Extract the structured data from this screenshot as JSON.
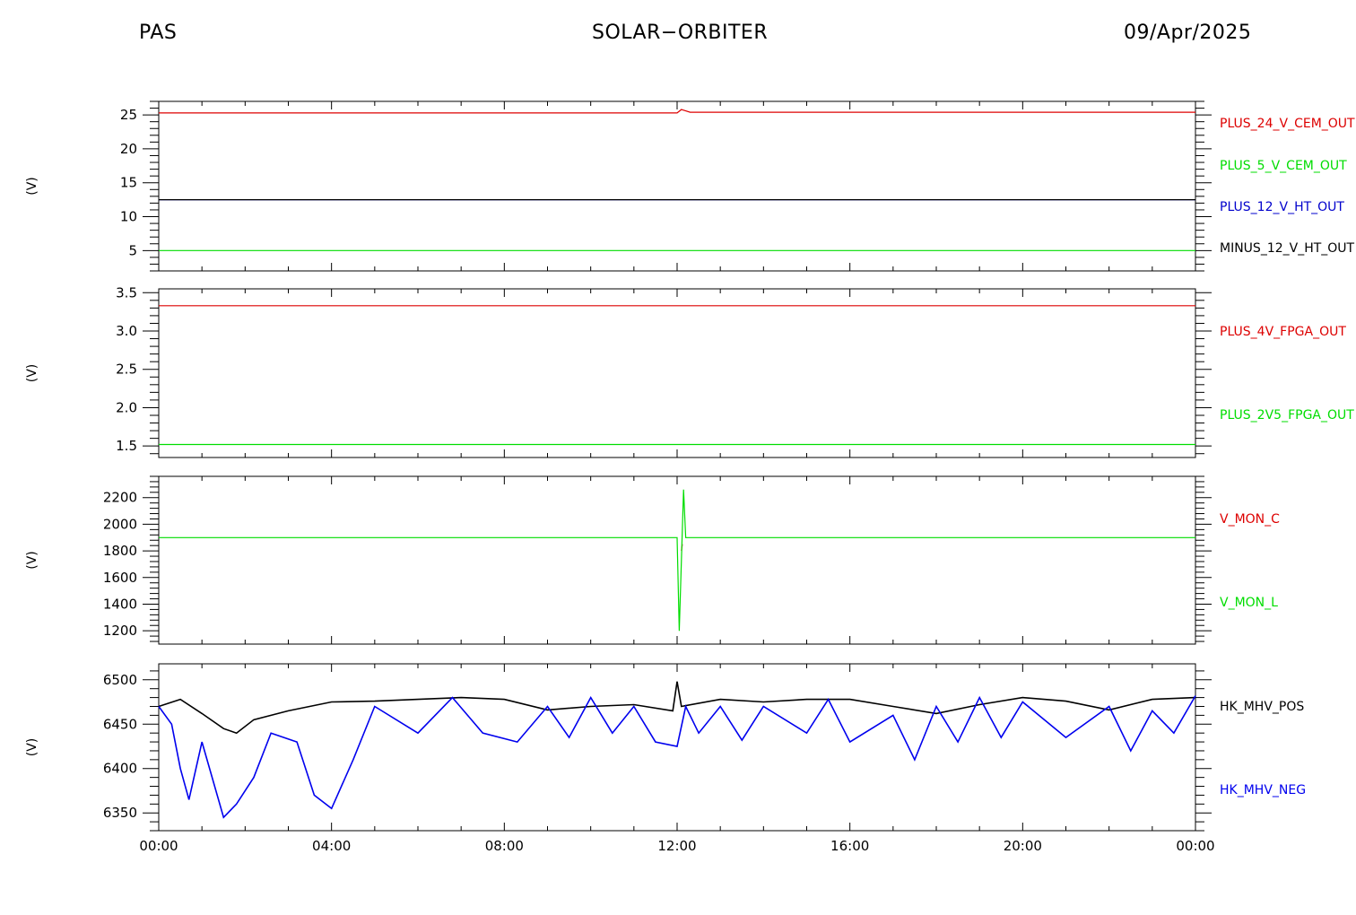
{
  "header": {
    "left": "PAS",
    "center": "SOLAR−ORBITER",
    "right": "09/Apr/2025"
  },
  "chart_data": [
    {
      "type": "line",
      "ylabel": "(V)",
      "ylim": [
        2,
        27
      ],
      "yticks": [
        5,
        10,
        15,
        20,
        25
      ],
      "xlim": [
        "00:00",
        "24:00"
      ],
      "series": [
        {
          "name": "PLUS_24_V_CEM_OUT",
          "color": "#dd0000",
          "x": [
            0,
            12,
            12.1,
            12.3,
            24
          ],
          "y": [
            25.3,
            25.3,
            25.8,
            25.4,
            25.4
          ]
        },
        {
          "name": "PLUS_5_V_CEM_OUT",
          "color": "#00dd00",
          "x": [
            0,
            24
          ],
          "y": [
            5.0,
            5.0
          ]
        },
        {
          "name": "PLUS_12_V_HT_OUT",
          "color": "#0000cc",
          "x": [
            0,
            24
          ],
          "y": [
            12.5,
            12.5
          ]
        },
        {
          "name": "MINUS_12_V_HT_OUT",
          "color": "#000000",
          "x": [
            0,
            24
          ],
          "y": [
            12.5,
            12.5
          ]
        }
      ]
    },
    {
      "type": "line",
      "ylabel": "(V)",
      "ylim": [
        1.35,
        3.55
      ],
      "yticks": [
        1.5,
        2.0,
        2.5,
        3.0,
        3.5
      ],
      "xlim": [
        "00:00",
        "24:00"
      ],
      "series": [
        {
          "name": "PLUS_4V_FPGA_OUT",
          "color": "#dd0000",
          "x": [
            0,
            24
          ],
          "y": [
            3.33,
            3.33
          ]
        },
        {
          "name": "PLUS_2V5_FPGA_OUT",
          "color": "#00dd00",
          "x": [
            0,
            24
          ],
          "y": [
            1.52,
            1.52
          ]
        }
      ]
    },
    {
      "type": "line",
      "ylabel": "(V)",
      "ylim": [
        1100,
        2360
      ],
      "yticks": [
        1200,
        1400,
        1600,
        1800,
        2000,
        2200
      ],
      "xlim": [
        "00:00",
        "24:00"
      ],
      "series": [
        {
          "name": "V_MON_C",
          "color": "#dd0000",
          "x": [
            12.1,
            12.12
          ],
          "y": [
            1800,
            1850
          ]
        },
        {
          "name": "V_MON_L",
          "color": "#00dd00",
          "x": [
            0,
            12.0,
            12.05,
            12.15,
            12.2,
            24
          ],
          "y": [
            1900,
            1900,
            1200,
            2260,
            1900,
            1900
          ]
        }
      ]
    },
    {
      "type": "line",
      "ylabel": "(V)",
      "ylim": [
        6330,
        6518
      ],
      "yticks": [
        6350,
        6400,
        6450,
        6500
      ],
      "xlim": [
        "00:00",
        "24:00"
      ],
      "series": [
        {
          "name": "HK_MHV_POS",
          "color": "#000000",
          "x": [
            0,
            0.5,
            1.0,
            1.5,
            1.8,
            2.2,
            3.0,
            4.0,
            5.0,
            6.0,
            7.0,
            8.0,
            9.0,
            10.0,
            11.0,
            11.9,
            12.0,
            12.1,
            13.0,
            14.0,
            15.0,
            16.0,
            17.0,
            18.0,
            19.0,
            20.0,
            21.0,
            22.0,
            23.0,
            24.0
          ],
          "y": [
            6470,
            6478,
            6462,
            6445,
            6440,
            6455,
            6465,
            6475,
            6476,
            6478,
            6480,
            6478,
            6466,
            6470,
            6472,
            6465,
            6498,
            6470,
            6478,
            6475,
            6478,
            6478,
            6470,
            6462,
            6472,
            6480,
            6476,
            6466,
            6478,
            6480
          ]
        },
        {
          "name": "HK_MHV_NEG",
          "color": "#0000ee",
          "x": [
            0,
            0.3,
            0.5,
            0.7,
            1.0,
            1.5,
            1.8,
            2.2,
            2.6,
            3.2,
            3.6,
            4.0,
            4.5,
            5.0,
            6.0,
            6.8,
            7.5,
            8.3,
            9.0,
            9.5,
            10.0,
            10.5,
            11.0,
            11.5,
            12.0,
            12.2,
            12.5,
            13.0,
            13.5,
            14.0,
            15.0,
            15.5,
            16.0,
            17.0,
            17.5,
            18.0,
            18.5,
            19.0,
            19.5,
            20.0,
            21.0,
            22.0,
            22.5,
            23.0,
            23.5,
            24.0
          ],
          "y": [
            6470,
            6450,
            6400,
            6365,
            6430,
            6345,
            6360,
            6390,
            6440,
            6430,
            6370,
            6355,
            6410,
            6470,
            6440,
            6480,
            6440,
            6430,
            6470,
            6435,
            6480,
            6440,
            6470,
            6430,
            6425,
            6470,
            6440,
            6470,
            6432,
            6470,
            6440,
            6478,
            6430,
            6460,
            6410,
            6470,
            6430,
            6480,
            6435,
            6475,
            6435,
            6470,
            6420,
            6465,
            6440,
            6482
          ]
        }
      ]
    }
  ],
  "xaxis": {
    "ticks": [
      "00:00",
      "04:00",
      "08:00",
      "12:00",
      "16:00",
      "20:00",
      "00:00"
    ]
  }
}
